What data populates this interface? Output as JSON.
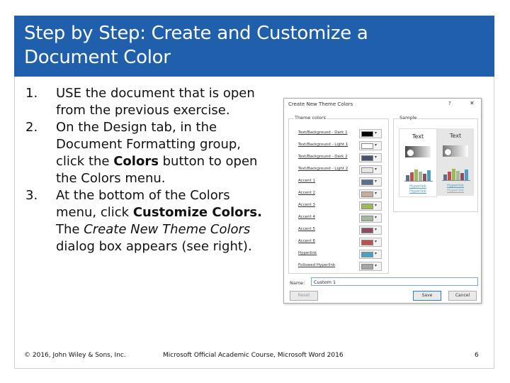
{
  "colors": {
    "title_bar": "#1f5fab"
  },
  "slide": {
    "title_line1": "Step by Step: Create and Customize a",
    "title_line2": "Document Color"
  },
  "steps": [
    {
      "num": "1.",
      "text": "USE the document that is open from the previous exercise."
    },
    {
      "num": "2.",
      "pre": "On the Design tab, in the Document Formatting group, click the ",
      "bold": "Colors",
      "post": " button to open the Colors menu."
    },
    {
      "num": "3.",
      "pre": "At the bottom of the Colors menu, click ",
      "bold": "Customize Colors.",
      "mid": " The ",
      "italic": "Create New Theme Colors",
      "post": " dialog box appears (see right)."
    }
  ],
  "dialog": {
    "title": "Create New Theme Colors",
    "help": "?",
    "close": "✕",
    "theme_colors_label": "Theme colors",
    "sample_label": "Sample",
    "rows": [
      {
        "label": "Text/Background - Dark 1",
        "color": "#000000"
      },
      {
        "label": "Text/Background - Light 1",
        "color": "#ffffff"
      },
      {
        "label": "Text/Background - Dark 2",
        "color": "#44546a"
      },
      {
        "label": "Text/Background - Light 2",
        "color": "#e7e6e6"
      },
      {
        "label": "Accent 1",
        "color": "#5b6f8c"
      },
      {
        "label": "Accent 2",
        "color": "#c8ad9a"
      },
      {
        "label": "Accent 3",
        "color": "#9bbb59"
      },
      {
        "label": "Accent 4",
        "color": "#a3b99b"
      },
      {
        "label": "Accent 5",
        "color": "#8c4d63"
      },
      {
        "label": "Accent 6",
        "color": "#c0504d"
      },
      {
        "label": "Hyperlink",
        "color": "#4f9fc4"
      },
      {
        "label": "Followed Hyperlink",
        "color": "#a5a5a5"
      }
    ],
    "sample": {
      "text": "Text",
      "hyperlink": "Hyperlink",
      "bars": [
        "#5b6f8c",
        "#c0504d",
        "#9bbb59",
        "#a3b99b",
        "#8c4d63",
        "#4f9fc4"
      ]
    },
    "name_label": "Name:",
    "name_value": "Custom 1",
    "reset": "Reset",
    "save": "Save",
    "cancel": "Cancel"
  },
  "footer": {
    "copyright": "© 2016, John Wiley & Sons, Inc.",
    "course": "Microsoft Official Academic Course, Microsoft Word 2016",
    "page": "6"
  }
}
